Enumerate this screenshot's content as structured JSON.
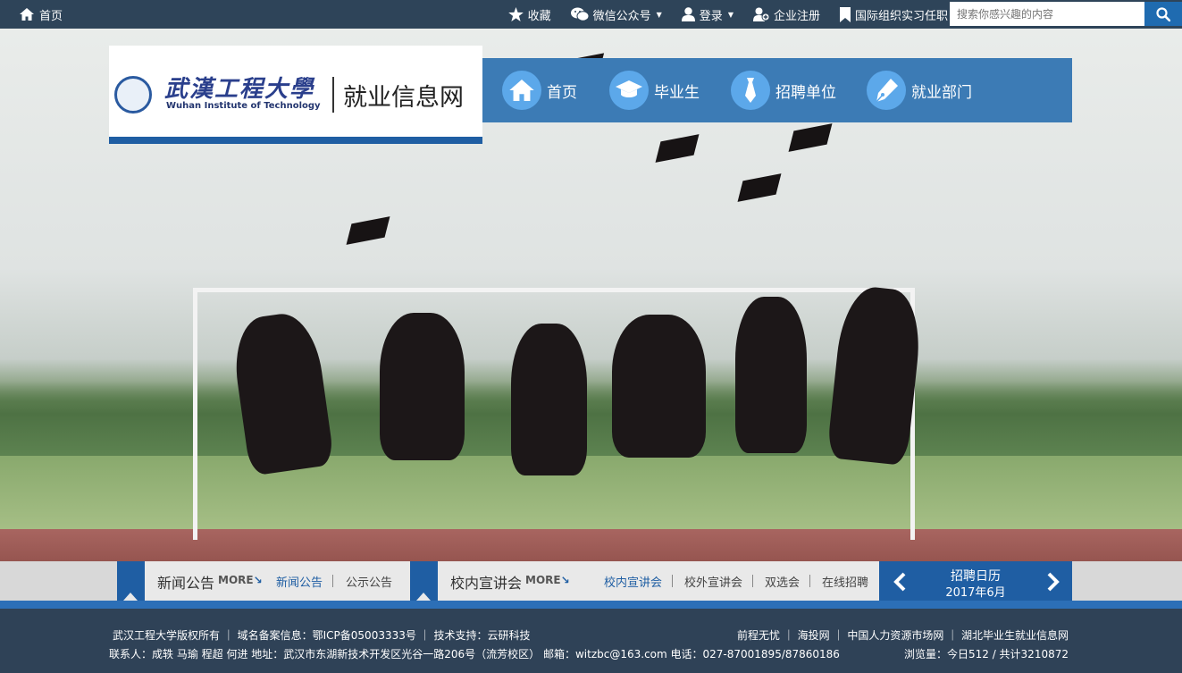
{
  "topbar": {
    "home_label": "首页",
    "links": [
      {
        "label": "收藏",
        "icon": "star-icon"
      },
      {
        "label": "微信公众号",
        "icon": "wechat-icon",
        "dropdown": true
      },
      {
        "label": "登录",
        "icon": "user-icon",
        "dropdown": true
      },
      {
        "label": "企业注册",
        "icon": "user-add-icon"
      },
      {
        "label": "国际组织实习任职",
        "icon": "bookmark-icon"
      }
    ],
    "search_placeholder": "搜索你感兴趣的内容"
  },
  "logo": {
    "cn_name": "武漢工程大學",
    "en_name": "Wuhan Institute of Technology",
    "site_name": "就业信息网"
  },
  "mainnav": [
    {
      "label": "首页",
      "icon": "home-icon"
    },
    {
      "label": "毕业生",
      "icon": "graduation-cap-icon"
    },
    {
      "label": "招聘单位",
      "icon": "tie-icon"
    },
    {
      "label": "就业部门",
      "icon": "pen-icon"
    }
  ],
  "news": {
    "title": "新闻公告",
    "more": "MORE",
    "tabs": [
      "新闻公告",
      "公示公告"
    ]
  },
  "talks": {
    "title": "校内宣讲会",
    "more": "MORE",
    "tabs": [
      "校内宣讲会",
      "校外宣讲会",
      "双选会",
      "在线招聘"
    ]
  },
  "calendar": {
    "title": "招聘日历",
    "date": "2017年6月"
  },
  "footer": {
    "line1_left": "武汉工程大学版权所有 ｜ 域名备案信息：鄂ICP备05003333号 ｜ 技术支持：云研科技",
    "line2_left": "联系人：成轶 马瑜 程超 何进 地址：武汉市东湖新技术开发区光谷一路206号（流芳校区） 邮箱：witzbc@163.com 电话：027-87001895/87860186",
    "links": [
      "前程无忧",
      "海投网",
      "中国人力资源市场网",
      "湖北毕业生就业信息网"
    ],
    "visits": "浏览量：今日512 / 共计3210872"
  },
  "colors": {
    "topbar": "#2e4459",
    "nav": "#3c7bb5",
    "accent": "#1f5ea3",
    "footer": "#2f4257"
  }
}
